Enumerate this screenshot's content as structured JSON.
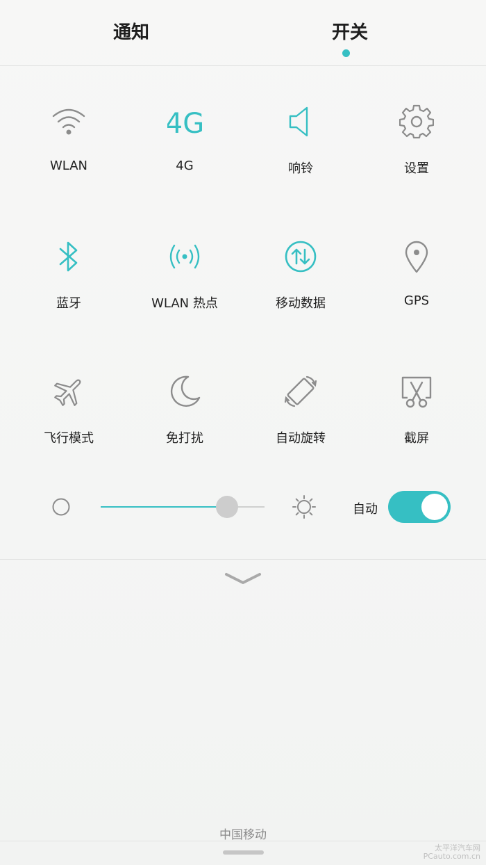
{
  "tabs": {
    "notify": "通知",
    "switch": "开关"
  },
  "colors": {
    "accent": "#36bfc3",
    "icon_gray": "#8c8c8c"
  },
  "tiles": [
    {
      "label": "WLAN",
      "icon": "wifi-icon",
      "active": false
    },
    {
      "label": "4G",
      "icon": "4g-icon",
      "icon_text": "4G",
      "active": true
    },
    {
      "label": "响铃",
      "icon": "speaker-icon",
      "active": true
    },
    {
      "label": "设置",
      "icon": "gear-icon",
      "active": false
    },
    {
      "label": "蓝牙",
      "icon": "bluetooth-icon",
      "active": true
    },
    {
      "label": "WLAN 热点",
      "icon": "hotspot-icon",
      "active": true
    },
    {
      "label": "移动数据",
      "icon": "mobile-data-icon",
      "active": true
    },
    {
      "label": "GPS",
      "icon": "location-pin-icon",
      "active": false
    },
    {
      "label": "飞行模式",
      "icon": "airplane-icon",
      "active": false
    },
    {
      "label": "免打扰",
      "icon": "moon-icon",
      "active": false
    },
    {
      "label": "自动旋转",
      "icon": "rotate-icon",
      "active": false
    },
    {
      "label": "截屏",
      "icon": "screenshot-icon",
      "active": false
    }
  ],
  "brightness": {
    "level": 0.77,
    "auto_label": "自动",
    "auto_enabled": true
  },
  "footer": {
    "carrier": "中国移动",
    "watermark_line1": "太平洋汽车网",
    "watermark_line2": "PCauto.com.cn"
  }
}
